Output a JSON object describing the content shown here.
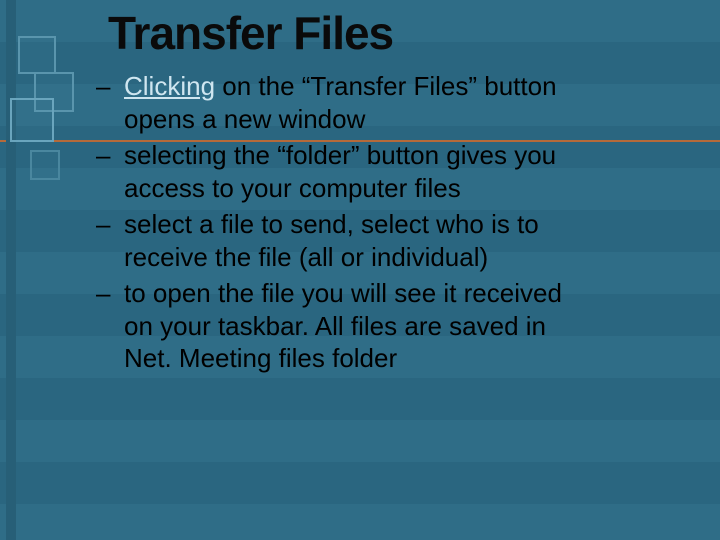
{
  "slide": {
    "title": "Transfer Files",
    "bullets": {
      "b0": {
        "dash": "–",
        "link_word": "Clicking",
        "rest": " on the “Transfer Files” button opens a new  window"
      },
      "b1": {
        "dash": "–",
        "text": "selecting the “folder” button gives you access to your computer files"
      },
      "b2": {
        "dash": "–",
        "text": "select a file to send, select who is to receive the file (all or individual)"
      },
      "b3": {
        "dash": "–",
        "text": "to open the file you will see it received on your taskbar. All files are saved in Net. Meeting files folder"
      }
    }
  }
}
